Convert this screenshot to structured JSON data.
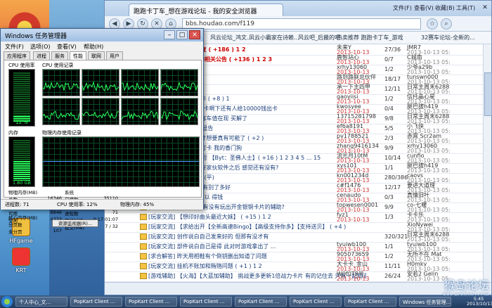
{
  "desktop": {
    "icons": [
      {
        "label": "HFgame"
      },
      {
        "label": "KRT"
      },
      {
        "label": "PopKart"
      },
      {
        "label": "腾讯"
      },
      {
        "label": "PPS"
      }
    ]
  },
  "browser": {
    "tab_title": "跑跑卡丁车_想在游戏论坛 - 我的安全浏览器",
    "menus": [
      "文件(F)",
      "查看(V)",
      "收藏(B)",
      "工具(T)",
      "帮助(H)"
    ],
    "url": "bbs.houdao.com/f119",
    "favorites": [
      "风云论坛_鸿文...",
      "风云小霸家在诗赖...",
      "风云吧_后搬的吧",
      "热卖推荐 跑跑卡丁车_游戏",
      "32赛车论坛-全新的...",
      "卡丁"
    ],
    "rows": [
      {
        "title": "有问活动 禁止无关回复 ( +186 ) 1 2",
        "author": "未来Y",
        "date": "2013-10-13",
        "replies": "27/36",
        "last": "JMR7",
        "lastdate": "2013-10-13 05:",
        "hl": true
      },
      {
        "title": "加期跑跑卡丁车骗取的相关公告 ( +136 ) 1 2 3",
        "author": "鹿智站心",
        "date": "2013-10-13",
        "replies": "0/7",
        "last": "C城南",
        "lastdate": "2013-10-13 05:",
        "hl": true
      },
      {
        "title": "有谁下",
        "author": "xrhy13060",
        "date": "2013-10-13",
        "replies": "1/2",
        "last": "少爷a29b",
        "lastdate": "2013-10-13 05:"
      },
      {
        "title": "的商店物品 ( +1 )",
        "author": "路到路联总伙伴",
        "date": "2013-10-13",
        "replies": "18/17",
        "last": "tunswn000",
        "lastdate": "2013-10-13 05:"
      },
      {
        "title": "外-计的成交",
        "author": "承一下主四甲",
        "date": "2013-10-13",
        "replies": "12/11",
        "last": "日常主周末6288",
        "lastdate": "2013-10-13 05:"
      },
      {
        "title": "老Y物在Bingo一球#卡 ( +8 ) 1",
        "author": "gaoyiisi",
        "date": "2013-10-13",
        "replies": "1/2",
        "last": "信托晶心星",
        "lastdate": "2013-10-13 05:"
      },
      {
        "title": "是5000钱说真实可30卡啊下还有人给10000钱出卡",
        "author": "kwosyee",
        "date": "2013-10-13",
        "replies": "0/4",
        "last": "腿巴拔h419",
        "lastdate": "2013-10-13 05:"
      },
      {
        "title": "高外香的资讯 天成通客车值在现 买解了",
        "author": "13715281798",
        "date": "2013-10-13",
        "replies": "9/8",
        "last": "日常主周末6288",
        "lastdate": "2013-10-13 05:"
      },
      {
        "title": "好了 玩了 100就速够显告",
        "author": "ef6a8191",
        "date": "2013-10-13",
        "replies": "5/5",
        "last": "小飞侠",
        "lastdate": "2013-10-13 05:"
      },
      {
        "title": "经完的都要你的 这个才想要真有可能了 ( +2 )",
        "author": "pv1788521",
        "date": "2013-10-13",
        "replies": "2/3",
        "last": "赤霄 Scr2am",
        "lastdate": "2013-10-13 05:"
      },
      {
        "title": "大神们谁打了 请到手打卡 我的香门狗",
        "author": "zhang9416134",
        "date": "2013-10-13",
        "replies": "9/9",
        "last": "xrhy13060",
        "lastdate": "2013-10-13 05:"
      },
      {
        "title": "我还卖吗 我的 10.13号 【Byt：圣佛人士】( +16 ) 1 2 3 4 5 ... 15",
        "author": "流光月10tM",
        "date": "2013-10-13",
        "replies": "10/14",
        "last": "cunfio",
        "lastdate": "2013-10-13 05:"
      },
      {
        "title": "怎么需要账户了 我要好家伙软件之后 感觉还有没有?",
        "author": "xys101",
        "date": "2013-10-13",
        "replies": "1/1",
        "last": "腿巴拔h419",
        "lastdate": "2013-10-13 05:"
      },
      {
        "title": "有玩跑卡打 天车打 好 (平)",
        "author": "kn001234d",
        "date": "2013-10-13",
        "replies": "280/386",
        "last": "caovs",
        "lastdate": "2013-10-13 05:"
      },
      {
        "title": "打卡门 真什么游戏了 有别了多好",
        "author": "c#f1476",
        "date": "2013-10-13",
        "replies": "12/17",
        "last": "要进大道理",
        "lastdate": "2013-10-13 05:"
      },
      {
        "title": "有无了 有什么 游戏 可以 得钱",
        "author": "cenaudo",
        "date": "2013-10-13",
        "replies": "0/3",
        "last": "真情旧叶",
        "lastdate": "2013-10-13 05:"
      },
      {
        "title": "[游戏辅助] BINGO片 有没有玩出开金银铜卡片的辅助?",
        "author": "topwesen0001",
        "date": "2013-10-13",
        "replies": "9/9",
        "last": "co-七暖",
        "lastdate": "2013-10-13 05:"
      },
      {
        "title": "[玩家交流] 【想印好曲头最近大妹】 ( +15 ) 1 2",
        "author": "fyz1",
        "date": "2013-10-13",
        "replies": "1/3",
        "last": "卡卡乐",
        "lastdate": "2013-10-13 05:"
      },
      {
        "title": "[玩家交流] 【求给出开【全新高速Bingo】【高级支持你多】【支持送贝】 ( +4 )",
        "author": "",
        "date": "",
        "replies": "",
        "last": "XioNywei",
        "lastdate": "2013-10-13 05:"
      },
      {
        "title": "[玩家交流] 创作说白自己发来好的 但那有没才有",
        "author": "",
        "date": "",
        "replies": "320/321",
        "last": "日常主周末6288",
        "lastdate": "2013-10-13 05:"
      },
      {
        "title": "[玩家交流] 部件说白自己是得 此对时游戏拿出了 ...",
        "author": "tyuiwb100",
        "date": "2013-10-13",
        "replies": "1/1",
        "last": "tyuiwb100",
        "lastdate": "2013-10-13 05:"
      },
      {
        "title": "[求合解答] 昨天用相鞋有个倒钥删出知道了问题",
        "author": "905073659",
        "date": "2013-10-13",
        "replies": "1/2",
        "last": "无所不在 Mat",
        "lastdate": "2013-10-13 05:"
      },
      {
        "title": "[玩家交流] 挂机不账加和贿赂问题 ( +1 ) 1 2",
        "author": "大卡卡_金山",
        "date": "2013-10-13",
        "replies": "11/11",
        "last": "H0mkv",
        "lastdate": "2013-10-13 05:"
      },
      {
        "title": "[游戏辅助] 【火海】【大蓝加辅助】 挑战更多更新1倍战力卡片 有的记住去 只有一起知道第上一次 ... 1 2 3",
        "author": "W0f0T8号",
        "date": "2013-10-13",
        "replies": "26/24",
        "last": "安若2 Gelin",
        "lastdate": "2013-10-13 05:"
      }
    ],
    "status": ""
  },
  "taskmgr": {
    "title": "Windows 任务管理器",
    "menus": [
      "文件(F)",
      "选项(O)",
      "查看(V)",
      "帮助(H)"
    ],
    "tabs": [
      "应用程序",
      "进程",
      "服务",
      "性能",
      "联网",
      "用户"
    ],
    "active_tab": 3,
    "cpu_label": "CPU 使用率",
    "cpu_hist_label": "CPU 使用记录",
    "cpu_value": "12 %",
    "mem_label": "内存",
    "mem_hist_label": "物理内存使用记录",
    "mem_value": "1.80 GB",
    "phys": {
      "head": "物理内存(MB)",
      "rows": [
        [
          "总数",
          "16346"
        ],
        [
          "已缓存",
          "5163"
        ],
        [
          "可用",
          "8846"
        ],
        [
          "空闲",
          "4773"
        ]
      ]
    },
    "kernel": {
      "head": "核心内存(MB)",
      "rows": [
        [
          "分页数",
          "388"
        ],
        [
          "未分页",
          "107"
        ]
      ]
    },
    "system": {
      "head": "系统",
      "rows": [
        [
          "句柄数",
          "35110"
        ],
        [
          "线程数",
          "1612"
        ],
        [
          "进程数",
          "71"
        ],
        [
          "开机时间",
          "0:17:01:07"
        ],
        [
          "提交(MB)",
          "7 / 32"
        ]
      ]
    },
    "resmon_button": "资源监视器(R)...",
    "status": {
      "procs": "进程数: 71",
      "cpu": "CPU 使用率: 12%",
      "mem": "物理内存: 45%"
    }
  },
  "taskbar": {
    "items": [
      "个人中心_文...",
      "PopKart Client ...",
      "PopKart Client ...",
      "PopKart Client ...",
      "PopKart Client ...",
      "PopKart Client ...",
      "PopKart Client ...",
      "Windows 任务管理..."
    ],
    "time": "5:45",
    "date": "2013/10/13"
  },
  "watermark": {
    "text": "猴岛论坛",
    "sub": "BBS.HOUDAO.COM"
  }
}
